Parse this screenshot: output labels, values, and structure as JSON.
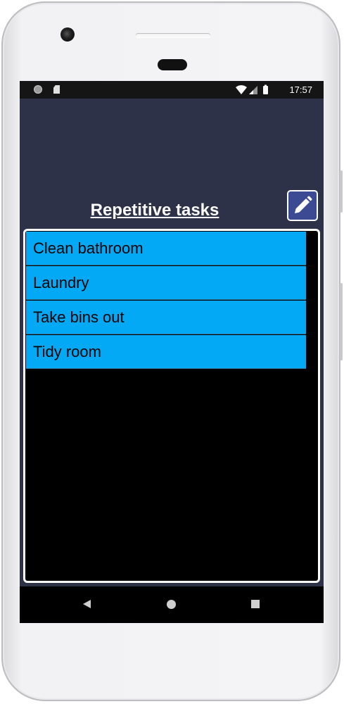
{
  "status_bar": {
    "time": "17:57",
    "icons": [
      "circle-notification-icon",
      "sd-card-icon",
      "wifi-icon",
      "cell-signal-icon",
      "battery-icon"
    ]
  },
  "header": {
    "title": "Repetitive tasks",
    "edit_icon": "pencil-icon"
  },
  "tasks": {
    "items": [
      {
        "label": "Clean bathroom"
      },
      {
        "label": "Laundry"
      },
      {
        "label": "Take bins out"
      },
      {
        "label": "Tidy room"
      }
    ]
  },
  "nav": {
    "icons": [
      "back-icon",
      "home-icon",
      "recents-icon"
    ]
  },
  "colors": {
    "background": "#2e3248",
    "list_item": "#03a9f4",
    "list_panel": "#000000",
    "edit_button": "#3b4a93"
  }
}
